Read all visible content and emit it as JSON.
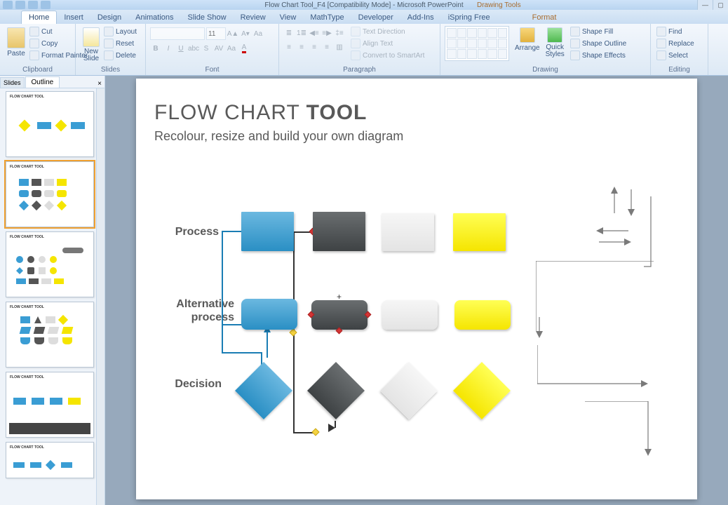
{
  "titlebar": {
    "title": "Flow Chart Tool_F4 [Compatibility Mode] - Microsoft PowerPoint",
    "context_label": "Drawing Tools"
  },
  "tabs": {
    "home": "Home",
    "insert": "Insert",
    "design": "Design",
    "animations": "Animations",
    "slideshow": "Slide Show",
    "review": "Review",
    "view": "View",
    "mathtype": "MathType",
    "developer": "Developer",
    "addins": "Add-Ins",
    "ispring": "iSpring Free",
    "format": "Format"
  },
  "ribbon": {
    "clipboard": {
      "label": "Clipboard",
      "paste": "Paste",
      "cut": "Cut",
      "copy": "Copy",
      "format_painter": "Format Painter"
    },
    "slides": {
      "label": "Slides",
      "new_slide": "New\nSlide",
      "layout": "Layout",
      "reset": "Reset",
      "delete": "Delete"
    },
    "font": {
      "label": "Font",
      "size": "11"
    },
    "paragraph": {
      "label": "Paragraph",
      "text_direction": "Text Direction",
      "align_text": "Align Text",
      "convert": "Convert to SmartArt"
    },
    "drawing": {
      "label": "Drawing",
      "arrange": "Arrange",
      "quick_styles": "Quick\nStyles",
      "shape_fill": "Shape Fill",
      "shape_outline": "Shape Outline",
      "shape_effects": "Shape Effects"
    },
    "editing": {
      "label": "Editing",
      "find": "Find",
      "replace": "Replace",
      "select": "Select"
    }
  },
  "panel": {
    "slides_tab": "Slides",
    "outline_tab": "Outline"
  },
  "slide": {
    "title_a": "FLOW CHART ",
    "title_b": "TOOL",
    "subtitle": "Recolour, resize and build your own diagram",
    "row1": "Process",
    "row2a": "Alternative",
    "row2b": "process",
    "row3": "Decision"
  }
}
